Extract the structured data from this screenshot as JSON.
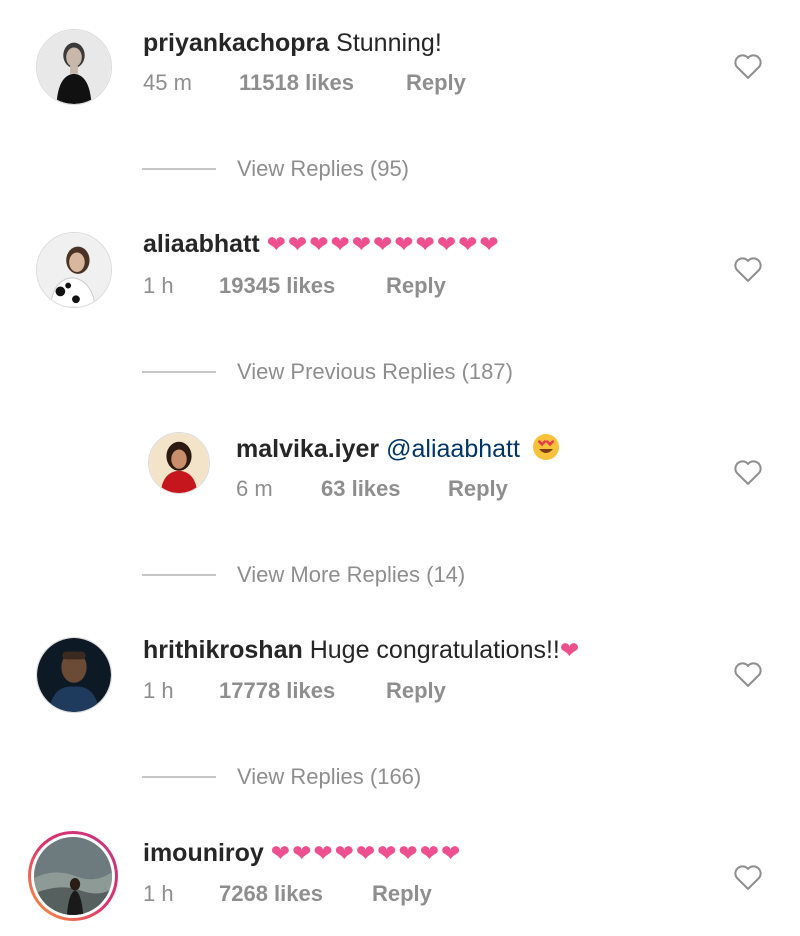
{
  "comments": [
    {
      "username": "priyankachopra",
      "text": "Stunning!",
      "time": "45 m",
      "likes": "11518 likes",
      "reply": "Reply"
    },
    {
      "username": "aliaabhatt",
      "text": "❤❤❤❤❤❤❤❤❤❤❤",
      "time": "1 h",
      "likes": "19345 likes",
      "reply": "Reply"
    },
    {
      "username": "malvika.iyer",
      "mention": "@aliaabhatt",
      "time": "6 m",
      "likes": "63 likes",
      "reply": "Reply"
    },
    {
      "username": "hrithikroshan",
      "text": "Huge congratulations!!",
      "heart": "❤",
      "time": "1 h",
      "likes": "17778 likes",
      "reply": "Reply"
    },
    {
      "username": "imouniroy",
      "text": "❤❤❤❤❤❤❤❤❤",
      "time": "1 h",
      "likes": "7268 likes",
      "reply": "Reply"
    }
  ],
  "view_replies": [
    "View Replies (95)",
    "View Previous Replies (187)",
    "View More Replies (14)",
    "View Replies (166)"
  ],
  "colors": {
    "heart": "#ed4f8f",
    "mention": "#003569",
    "meta": "#8e8e8e"
  },
  "icons": {
    "like": "heart-outline-icon",
    "emoji": "heart-eyes-emoji"
  }
}
